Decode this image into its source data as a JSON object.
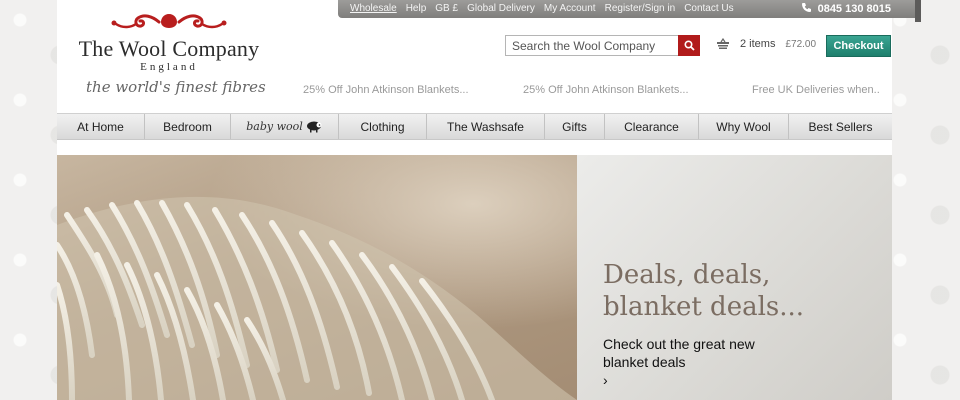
{
  "utility": {
    "links": [
      "Wholesale",
      "Help",
      "GB £",
      "Global Delivery",
      "My Account",
      "Register/Sign in",
      "Contact Us"
    ],
    "phone": "0845 130 8015"
  },
  "brand": {
    "name": "The Wool Company",
    "sub": "England",
    "tagline": "the world's finest fibres"
  },
  "search": {
    "placeholder": "Search the Wool Company"
  },
  "basket": {
    "items": "2 items",
    "total": "£72.00",
    "checkout_label": "Checkout"
  },
  "promos": [
    "25% Off John Atkinson Blankets...",
    "25% Off John Atkinson Blankets...",
    "Free UK Deliveries when..."
  ],
  "nav": {
    "items": [
      "At Home",
      "Bedroom",
      "baby wool",
      "Clothing",
      "The Washsafe",
      "Gifts",
      "Clearance",
      "Why Wool",
      "Best Sellers"
    ]
  },
  "hero": {
    "heading_line1": "Deals, deals,",
    "heading_line2": "blanket deals...",
    "sub_line1": "Check out the great new",
    "sub_line2": "blanket deals",
    "sub_arrow": "›"
  },
  "colors": {
    "accent_red": "#b11b1b",
    "checkout_green": "#2a9583",
    "hero_heading": "#7b6d62"
  },
  "icons": [
    "search-icon",
    "basket-icon",
    "phone-icon",
    "sheep-icon"
  ]
}
